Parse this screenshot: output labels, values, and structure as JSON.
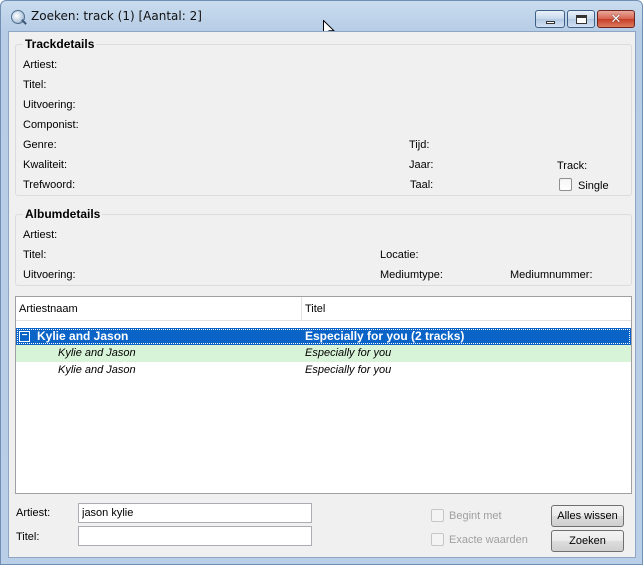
{
  "window": {
    "title": "Zoeken: track (1) [Aantal: 2]"
  },
  "trackdetails": {
    "title": "Trackdetails",
    "artiest": "Artiest:",
    "titel": "Titel:",
    "uitvoering": "Uitvoering:",
    "componist": "Componist:",
    "genre": "Genre:",
    "kwaliteit": "Kwaliteit:",
    "trefwoord": "Trefwoord:",
    "tijd": "Tijd:",
    "jaar": "Jaar:",
    "taal": "Taal:",
    "track": "Track:",
    "single": "Single"
  },
  "albumdetails": {
    "title": "Albumdetails",
    "artiest": "Artiest:",
    "titel": "Titel:",
    "uitvoering": "Uitvoering:",
    "locatie": "Locatie:",
    "mediumtype": "Mediumtype:",
    "mediumnummer": "Mediumnummer:"
  },
  "results": {
    "columns": [
      "Artiestnaam",
      "Titel"
    ],
    "group": {
      "artist": "Kylie and Jason",
      "title": "Especially for you (2 tracks)",
      "expander": "−"
    },
    "rows": [
      {
        "artist": "Kylie and Jason",
        "title": "Especially for you"
      },
      {
        "artist": "Kylie and Jason",
        "title": "Especially for you"
      }
    ]
  },
  "search": {
    "artiest_label": "Artiest:",
    "artiest_value": "jason kylie",
    "titel_label": "Titel:",
    "titel_value": "",
    "begint_met": "Begint met",
    "exacte_waarden": "Exacte waarden",
    "alles_wissen": "Alles wissen",
    "zoeken": "Zoeken"
  },
  "colors": {
    "selection": "#0a64c7",
    "highlight_row": "#d8f4d8"
  }
}
